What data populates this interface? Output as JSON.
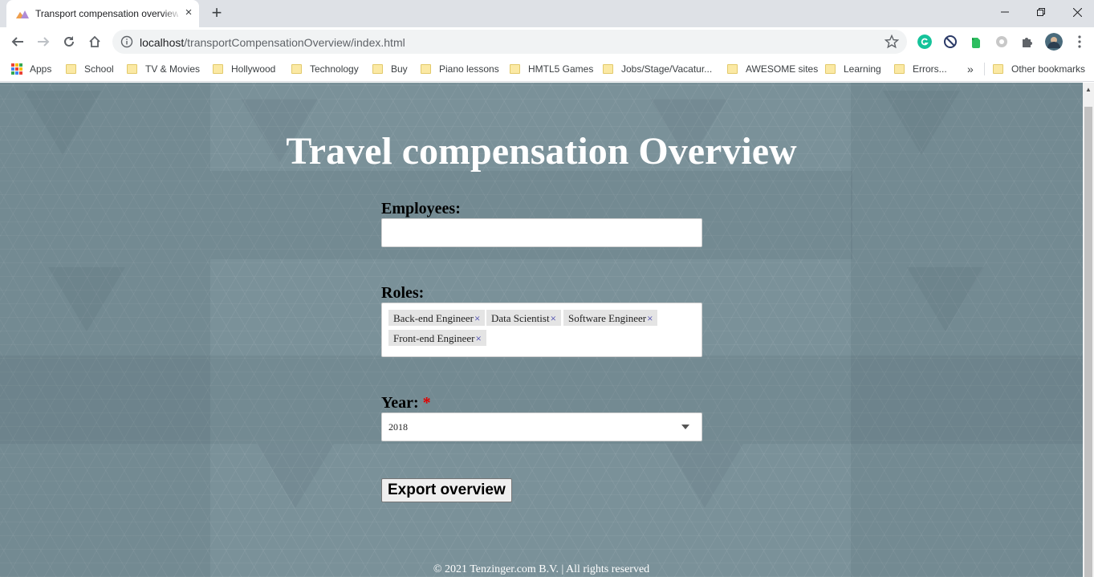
{
  "browser": {
    "tab_title": "Transport compensation overview",
    "tab_close": "×",
    "new_tab": "+",
    "url_host": "localhost",
    "url_path": "/transportCompensationOverview/index.html"
  },
  "bookmarks": {
    "apps_label": "Apps",
    "items": [
      "School",
      "TV & Movies",
      "Hollywood",
      "Technology",
      "Buy",
      "Piano lessons",
      "HMTL5 Games",
      "Jobs/Stage/Vacatur...",
      "AWESOME sites",
      "Learning",
      "Errors..."
    ],
    "overflow": "»",
    "other": "Other bookmarks"
  },
  "page": {
    "title": "Travel compensation Overview",
    "employees_label": "Employees:",
    "employees_value": "",
    "roles_label": "Roles:",
    "roles": [
      "Back-end Engineer",
      "Data Scientist",
      "Software Engineer",
      "Front-end Engineer"
    ],
    "tag_remove": "×",
    "year_label": "Year:",
    "year_required": "*",
    "year_value": "2018",
    "export_button": "Export overview",
    "footer": "© 2021 Tenzinger.com B.V. | All rights reserved"
  },
  "colors": {
    "page_background": "#7a9199",
    "required_marker": "#e00000",
    "tag_background": "#e4e4e4",
    "tag_remove": "#3a3aa8"
  }
}
